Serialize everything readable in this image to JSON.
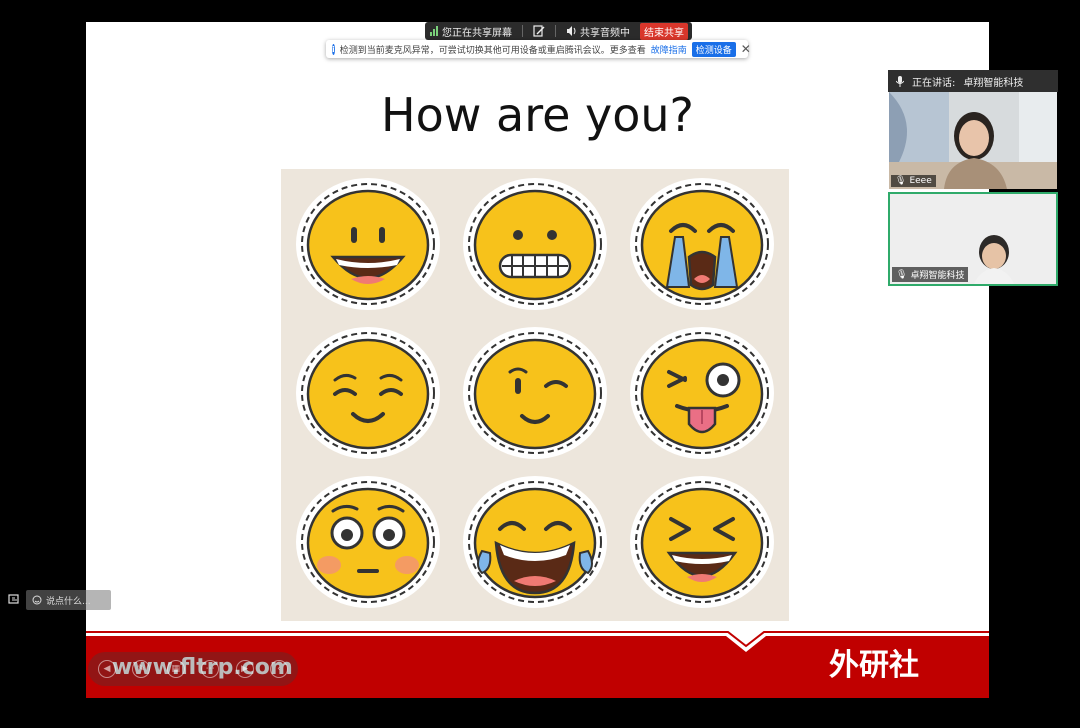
{
  "sharebar": {
    "sharing_label": "您正在共享屏幕",
    "audio_label": "共享音频中",
    "end_label": "结束共享"
  },
  "notice": {
    "message": "检测到当前麦克风异常，可尝试切换其他可用设备或重启腾讯会议。更多查看",
    "link_label": "故障指南",
    "button_label": "检测设备"
  },
  "slide": {
    "title": "How are you?",
    "footer_url": "www.fltrp.com",
    "footer_logo": "外研社"
  },
  "participants": {
    "speaking_label": "正在讲话:",
    "speaking_name": "卓翔智能科技",
    "tile1_name": "Eeee",
    "tile2_name": "卓翔智能科技"
  },
  "chat": {
    "placeholder": "说点什么..."
  },
  "colors": {
    "footer_red": "#c00000",
    "emoji_yellow": "#f7c21b",
    "panel_bg": "#ede6dc",
    "accent_blue": "#1a6fe8",
    "end_red": "#d9362b",
    "active_green": "#2faa6a"
  }
}
